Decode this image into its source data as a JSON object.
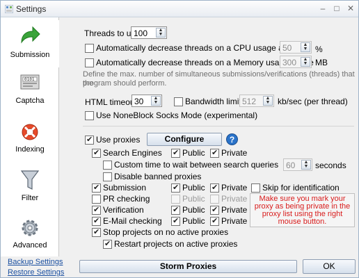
{
  "window": {
    "title": "Settings",
    "minimize": "–",
    "maximize": "□",
    "close": "✕"
  },
  "sidebar": {
    "items": [
      {
        "label": "Submission",
        "icon": "arrow-icon"
      },
      {
        "label": "Captcha",
        "icon": "captcha-icon"
      },
      {
        "label": "Indexing",
        "icon": "lifebuoy-icon"
      },
      {
        "label": "Filter",
        "icon": "funnel-icon"
      },
      {
        "label": "Advanced",
        "icon": "gear-icon"
      }
    ],
    "links": [
      "Backup Settings",
      "Restore Settings"
    ]
  },
  "threads": {
    "label": "Threads to use",
    "value": "100",
    "cpu_label": "Automatically decrease threads on a CPU usage above",
    "cpu_value": "50",
    "cpu_unit": "%",
    "mem_label": "Automatically decrease threads on a Memory usage above",
    "mem_value": "300",
    "mem_unit": "MB",
    "hint_line1": "Define the max. number of simultaneous submissions/verifications (threads) that the",
    "hint_line2": "program should perform."
  },
  "html_timeout": {
    "label": "HTML timeout",
    "value": "30"
  },
  "bandwidth": {
    "label": "Bandwidth limit",
    "value": "512",
    "unit": "kb/sec (per thread)"
  },
  "noneblock_label": "Use NoneBlock Socks Mode (experimental)",
  "proxies": {
    "use_label": "Use proxies",
    "configure_label": "Configure",
    "help": "?",
    "public": "Public",
    "private": "Private",
    "search_engines": "Search Engines",
    "custom_time": "Custom time to wait between search queries",
    "custom_time_value": "60",
    "seconds": "seconds",
    "disable_banned": "Disable banned proxies",
    "submission": "Submission",
    "skip_identification": "Skip for identification",
    "pr_checking": "PR checking",
    "verification": "Verification",
    "email_checking": "E-Mail checking",
    "stop_projects": "Stop projects on no active proxies",
    "restart_projects": "Restart projects on active proxies",
    "note": "Make sure you mark your proxy as being private in the proxy list using the right mouse button."
  },
  "footer": {
    "storm_label": "Storm Proxies",
    "ok_label": "OK"
  },
  "colors": {
    "note_text": "#d81b1b",
    "link": "#1a4fa0",
    "help_bg": "#2a73c9"
  }
}
